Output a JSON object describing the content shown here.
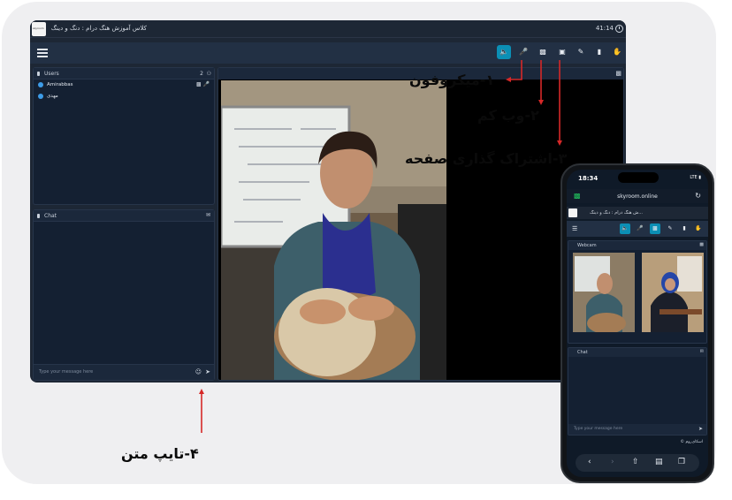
{
  "desktop": {
    "title": "کلاس آموزش هنگ درام : دنگ و دینگ",
    "clock": "41:14",
    "users": {
      "label": "Users",
      "count": "2",
      "list": [
        {
          "name": "Amirabbas"
        },
        {
          "name": "مهدی"
        }
      ]
    },
    "chat": {
      "label": "Chat",
      "placeholder": "Type your message here"
    },
    "toolbar_icons": [
      "speaker-icon",
      "mic-icon",
      "webcam-icon",
      "screen-share-icon",
      "brush-icon",
      "folder-icon",
      "file-icon",
      "hand-icon"
    ]
  },
  "annotations": {
    "mic": "۱-میکروفون",
    "webcam": "۲-وب کم",
    "screen_share": "۳-اشتراک گذاری صفحه",
    "typing": "۴-تایپ متن"
  },
  "phone": {
    "time": "18:34",
    "network": "LTE",
    "url": "skyroom.online",
    "title": "...ش هنگ درام : دنگ و دینگ",
    "webcam_label": "Webcam",
    "chat_label": "Chat",
    "chat_placeholder": "Type your message here",
    "brand": "اسکای‌روم ©"
  },
  "colors": {
    "accent": "#0b8fb5",
    "annotation_arrow": "#d62828",
    "panel_bg": "#142032",
    "window_bg": "#1d2735"
  }
}
